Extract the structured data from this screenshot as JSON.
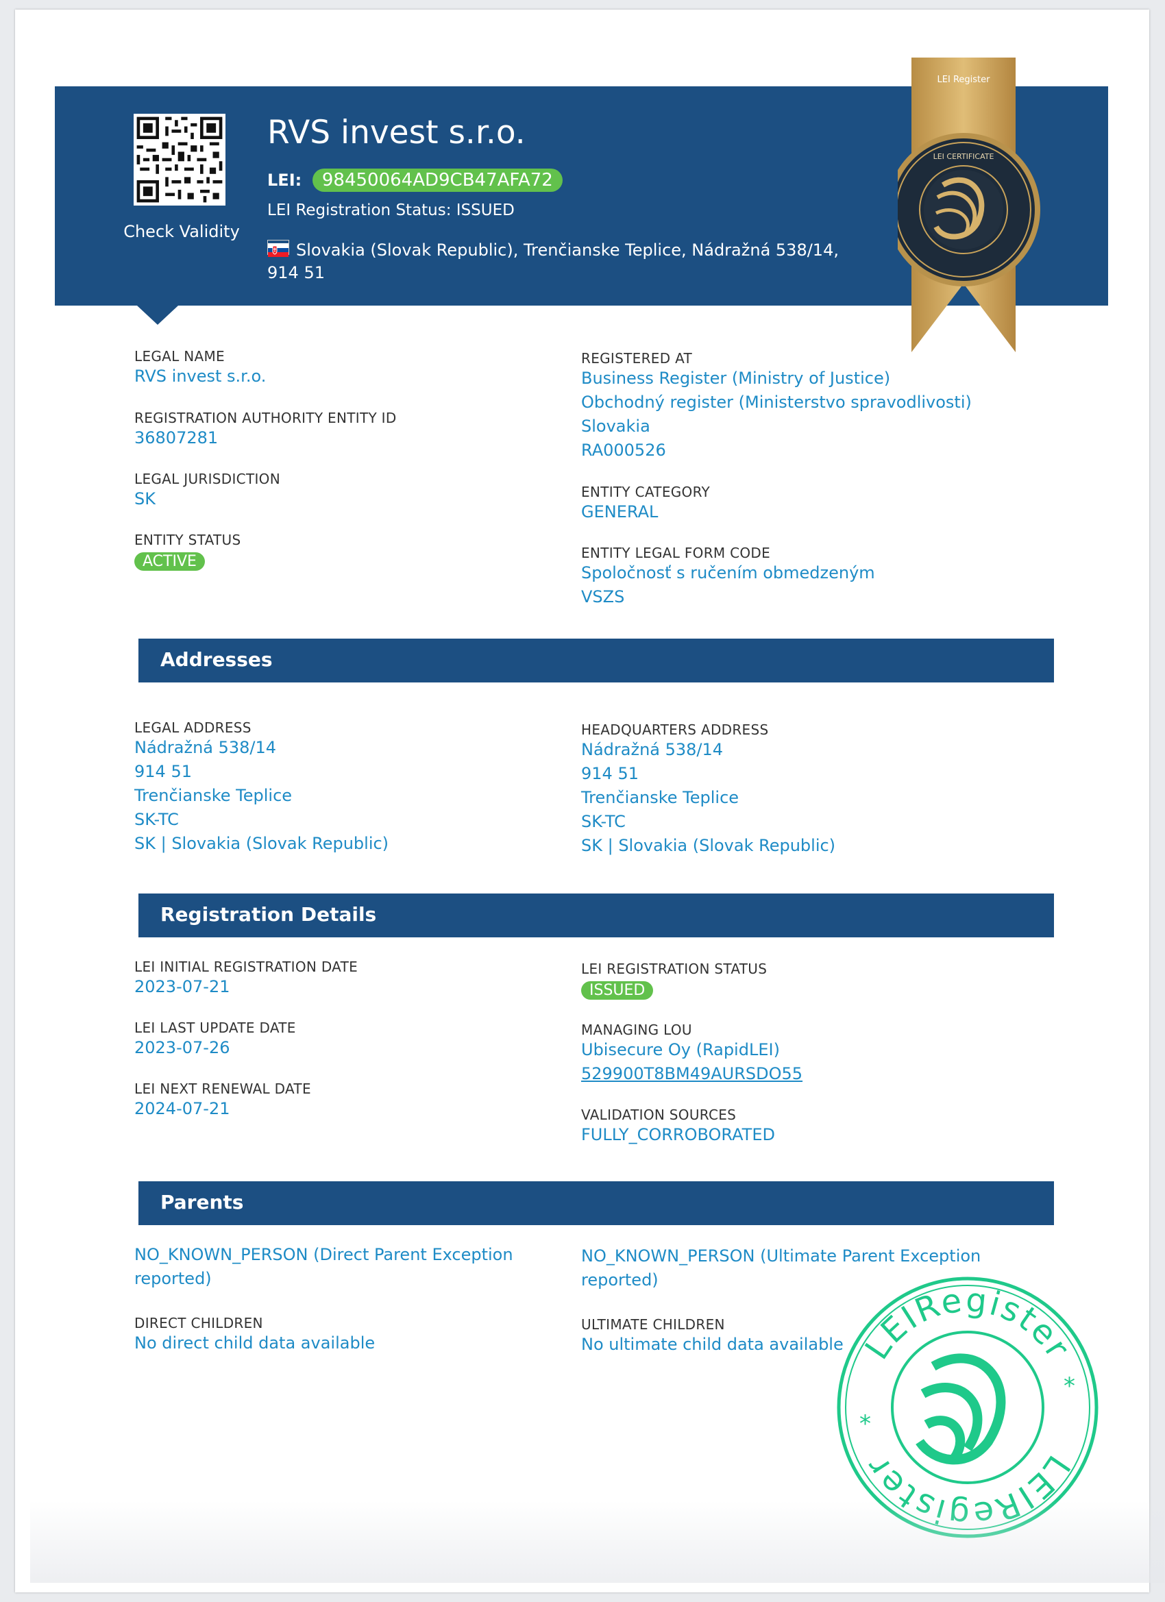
{
  "header": {
    "company_name": "RVS invest s.r.o.",
    "lei_label": "LEI:",
    "lei_code": "98450064AD9CB47AFA72",
    "registration_status": "LEI Registration Status: ISSUED",
    "address": "Slovakia (Slovak Republic), Trenčianske Teplice, Nádražná 538/14, 914 51",
    "check_validity": "Check Validity",
    "ribbon_text": "LEI Register",
    "seal_text": "LEI CERTIFICATE"
  },
  "entity": {
    "legal_name_label": "LEGAL NAME",
    "legal_name": "RVS invest s.r.o.",
    "ra_entity_id_label": "REGISTRATION AUTHORITY ENTITY ID",
    "ra_entity_id": "36807281",
    "jurisdiction_label": "LEGAL JURISDICTION",
    "jurisdiction": "SK",
    "status_label": "ENTITY STATUS",
    "status": "ACTIVE",
    "registered_at_label": "REGISTERED AT",
    "registered_at": [
      "Business Register (Ministry of Justice)",
      "Obchodný register (Ministerstvo spravodlivosti)",
      "Slovakia",
      "RA000526"
    ],
    "category_label": "ENTITY CATEGORY",
    "category": "GENERAL",
    "legal_form_label": "ENTITY LEGAL FORM CODE",
    "legal_form": [
      "Spoločnosť s ručením obmedzeným",
      "VSZS"
    ]
  },
  "addresses": {
    "title": "Addresses",
    "legal_label": "LEGAL ADDRESS",
    "legal": [
      "Nádražná 538/14",
      "914 51",
      "Trenčianske Teplice",
      "SK-TC",
      "SK | Slovakia (Slovak Republic)"
    ],
    "hq_label": "HEADQUARTERS ADDRESS",
    "hq": [
      "Nádražná 538/14",
      "914 51",
      "Trenčianske Teplice",
      "SK-TC",
      "SK | Slovakia (Slovak Republic)"
    ]
  },
  "registration": {
    "title": "Registration Details",
    "initial_label": "LEI INITIAL REGISTRATION DATE",
    "initial": "2023-07-21",
    "last_update_label": "LEI LAST UPDATE DATE",
    "last_update": "2023-07-26",
    "next_renewal_label": "LEI NEXT RENEWAL DATE",
    "next_renewal": "2024-07-21",
    "status_label": "LEI REGISTRATION STATUS",
    "status": "ISSUED",
    "lou_label": "MANAGING LOU",
    "lou_name": "Ubisecure Oy (RapidLEI)",
    "lou_code": "529900T8BM49AURSDO55",
    "validation_label": "VALIDATION SOURCES",
    "validation": "FULLY_CORROBORATED"
  },
  "parents": {
    "title": "Parents",
    "direct_parent": "NO_KNOWN_PERSON (Direct Parent Exception reported)",
    "ultimate_parent": "NO_KNOWN_PERSON (Ultimate Parent Exception reported)",
    "direct_children_label": "DIRECT CHILDREN",
    "direct_children": "No direct child data available",
    "ultimate_children_label": "ULTIMATE CHILDREN",
    "ultimate_children": "No ultimate child data available"
  },
  "stamp": {
    "text": "LEIRegister"
  },
  "colors": {
    "header_blue": "#1c4f82",
    "link_blue": "#1e8bc6",
    "status_green": "#62c14c",
    "stamp_green": "#1fc98a",
    "ribbon_gold": "#c9a35a"
  }
}
